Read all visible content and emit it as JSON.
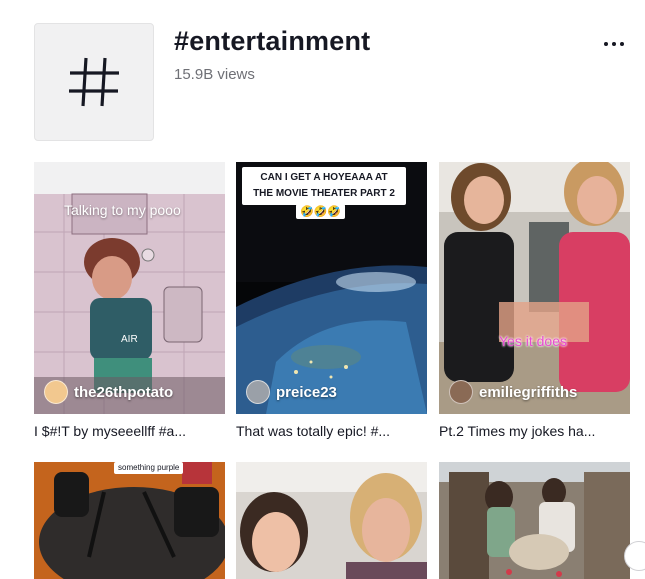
{
  "tag": {
    "title": "#entertainment",
    "views": "15.9B views",
    "icon": "hashtag-icon"
  },
  "more_menu": {
    "icon": "more-horizontal-icon"
  },
  "videos": [
    {
      "author": "the26thpotato",
      "caption": "I $#!T by myseeellff #a...",
      "overlay": "Talking to my pooo",
      "shirt_text": "AIR"
    },
    {
      "author": "preice23",
      "caption": "That was totally epic! #...",
      "sticker_line1": "CAN I GET A HOYEAAA AT",
      "sticker_line2": "THE MOVIE THEATER PART 2",
      "sticker_emoji": "🤣🤣🤣"
    },
    {
      "author": "emiliegriffiths",
      "caption": "Pt.2 Times my jokes ha...",
      "overlay": "Yes it does"
    },
    {
      "sticker": "something purple"
    },
    {},
    {}
  ],
  "colors": {
    "overlay_pink": "#e84bd0",
    "accent": "#fe2c55"
  }
}
